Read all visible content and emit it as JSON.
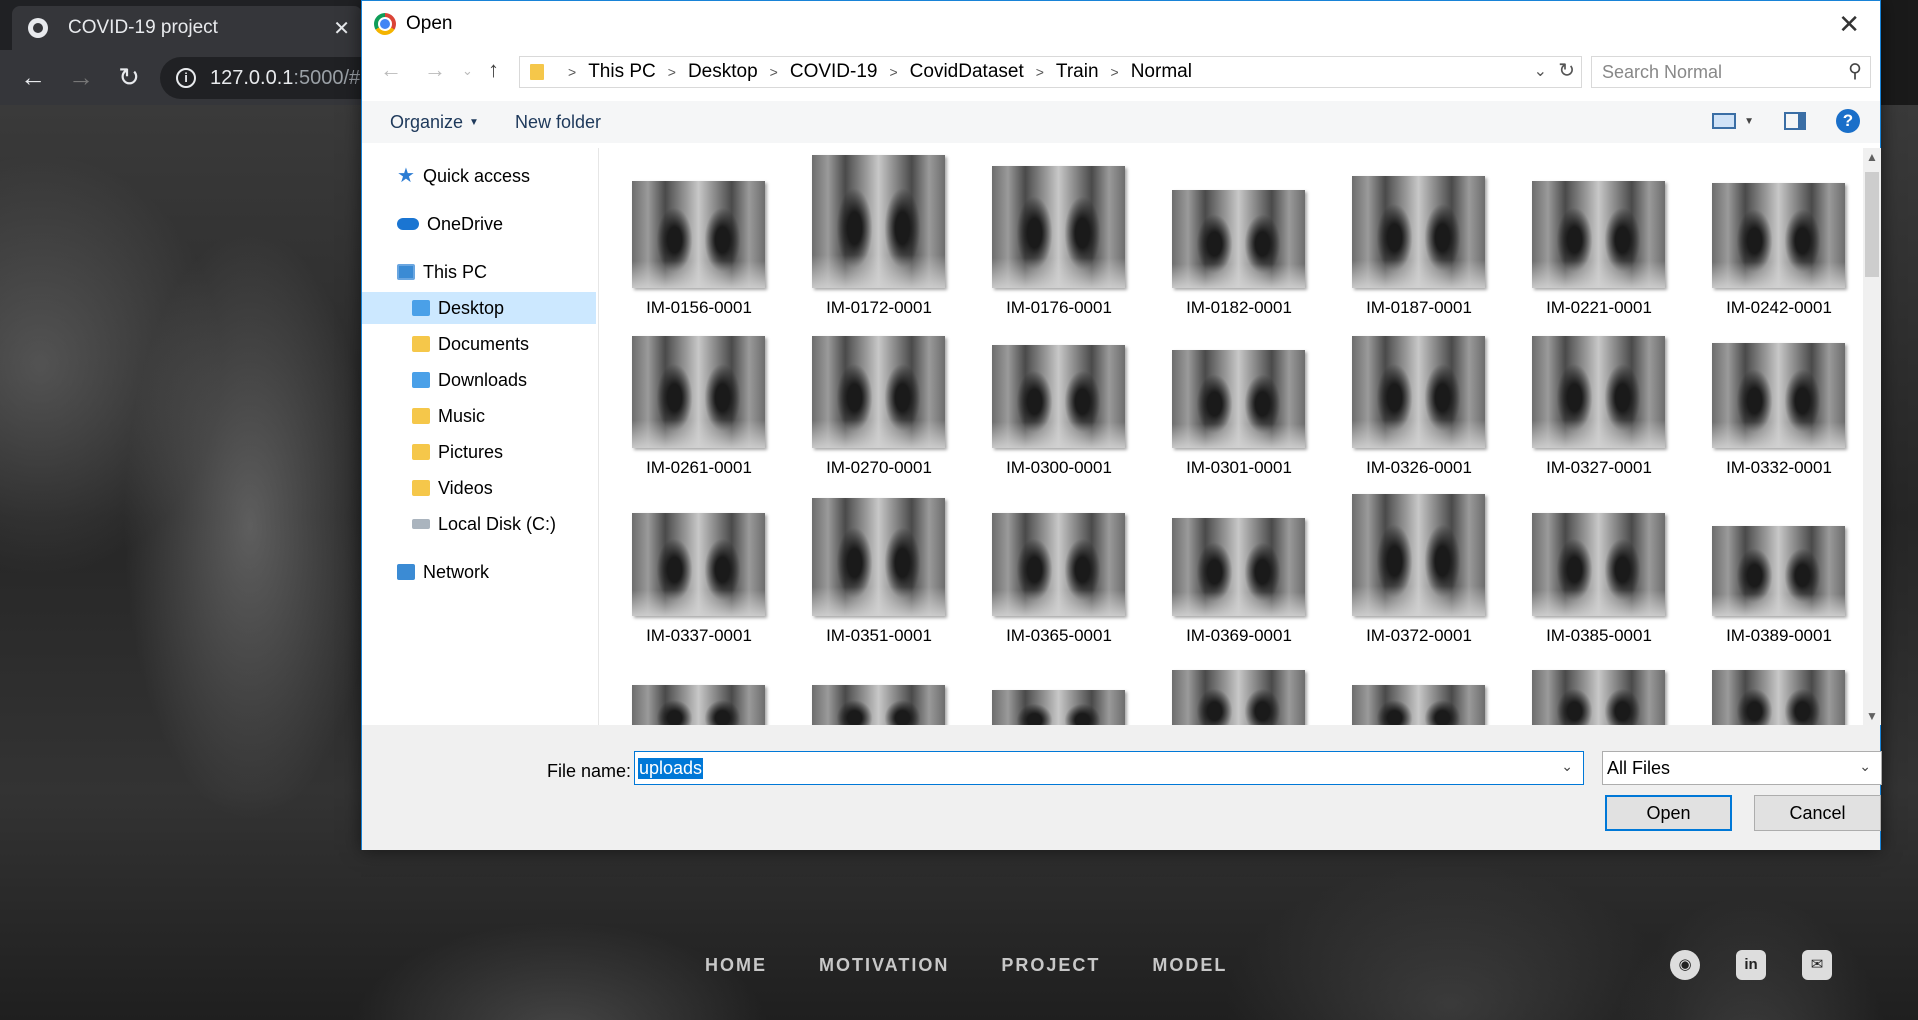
{
  "browser": {
    "tab_title": "COVID-19 project",
    "tab_close": "✕",
    "url_host": "127.0.0.1",
    "url_rest": ":5000/#"
  },
  "site": {
    "nav": [
      "HOME",
      "MOTIVATION",
      "PROJECT",
      "MODEL"
    ],
    "social_icons": [
      "github-icon",
      "linkedin-icon",
      "email-icon"
    ]
  },
  "dialog": {
    "title": "Open",
    "breadcrumb": [
      "This PC",
      "Desktop",
      "COVID-19",
      "CovidDataset",
      "Train",
      "Normal"
    ],
    "search_placeholder": "Search Normal",
    "toolbar": {
      "organize": "Organize",
      "new_folder": "New folder"
    },
    "nav_items": [
      {
        "label": "Quick access",
        "icon": "quick-access-star-icon"
      },
      {
        "label": "OneDrive",
        "icon": "onedrive-cloud-icon"
      },
      {
        "label": "This PC",
        "icon": "this-pc-icon"
      },
      {
        "label": "Desktop",
        "icon": "desktop-folder-icon",
        "selected": true
      },
      {
        "label": "Documents",
        "icon": "documents-folder-icon"
      },
      {
        "label": "Downloads",
        "icon": "downloads-folder-icon"
      },
      {
        "label": "Music",
        "icon": "music-folder-icon"
      },
      {
        "label": "Pictures",
        "icon": "pictures-folder-icon"
      },
      {
        "label": "Videos",
        "icon": "videos-folder-icon"
      },
      {
        "label": "Local Disk (C:)",
        "icon": "local-disk-icon"
      },
      {
        "label": "Network",
        "icon": "network-icon"
      }
    ],
    "files": [
      "IM-0156-0001",
      "IM-0172-0001",
      "IM-0176-0001",
      "IM-0182-0001",
      "IM-0187-0001",
      "IM-0221-0001",
      "IM-0242-0001",
      "IM-0261-0001",
      "IM-0270-0001",
      "IM-0300-0001",
      "IM-0301-0001",
      "IM-0326-0001",
      "IM-0327-0001",
      "IM-0332-0001",
      "IM-0337-0001",
      "IM-0351-0001",
      "IM-0365-0001",
      "IM-0369-0001",
      "IM-0372-0001",
      "IM-0385-0001",
      "IM-0389-0001"
    ],
    "file_name_label": "File name:",
    "file_name_value": "uploads",
    "file_type": "All Files",
    "open_label": "Open",
    "cancel_label": "Cancel"
  }
}
